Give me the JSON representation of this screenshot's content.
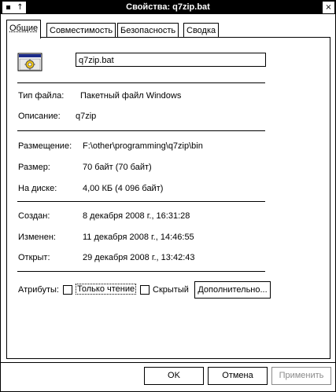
{
  "window": {
    "title": "Свойства: q7zip.bat",
    "pin_icon": "pin-icon",
    "up_icon": "arrow-up-icon",
    "close_icon": "close-icon"
  },
  "tabs": [
    {
      "label": "Общие",
      "active": true
    },
    {
      "label": "Совместимость",
      "active": false
    },
    {
      "label": "Безопасность",
      "active": false
    },
    {
      "label": "Сводка",
      "active": false
    }
  ],
  "general": {
    "file_icon": "batch-file-icon",
    "filename": "q7zip.bat",
    "type_label": "Тип файла:",
    "type_value": "Пакетный файл Windows",
    "description_label": "Описание:",
    "description_value": "q7zip",
    "location_label": "Размещение:",
    "location_value": "F:\\other\\programming\\q7zip\\bin",
    "size_label": "Размер:",
    "size_value": "70 байт (70 байт)",
    "ondisk_label": "На диске:",
    "ondisk_value": "4,00 КБ (4 096 байт)",
    "created_label": "Создан:",
    "created_value": "8 декабря 2008 г., 16:31:28",
    "modified_label": "Изменен:",
    "modified_value": "11 декабря 2008 г., 14:46:55",
    "accessed_label": "Открыт:",
    "accessed_value": "29 декабря 2008 г., 13:42:43",
    "attributes_label": "Атрибуты:",
    "readonly_label": "Только чтение",
    "hidden_label": "Скрытый",
    "advanced_button": "Дополнительно..."
  },
  "footer": {
    "ok": "OK",
    "cancel": "Отмена",
    "apply": "Применить"
  },
  "colors": {
    "titlebar": "#000000",
    "disabled_text": "#8a8a8a"
  }
}
